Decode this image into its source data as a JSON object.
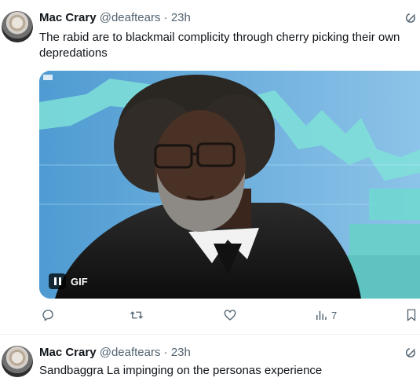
{
  "tweets": [
    {
      "name": "Mac Crary",
      "handle": "@deaftears",
      "dot": "·",
      "time": "23h",
      "text": "The rabid are to blackmail complicity through cherry picking their own depredations",
      "media": {
        "type": "GIF",
        "gif_label": "GIF"
      },
      "actions": {
        "views": "7"
      }
    },
    {
      "name": "Mac Crary",
      "handle": "@deaftears",
      "dot": "·",
      "time": "23h",
      "text": "Sandbaggra La impinging on the personas experience"
    }
  ],
  "icons": {
    "reply": "reply-icon",
    "retweet": "retweet-icon",
    "like": "like-icon",
    "views": "views-icon",
    "bookmark": "bookmark-icon",
    "grok": "grok-icon",
    "pause": "pause-icon"
  }
}
